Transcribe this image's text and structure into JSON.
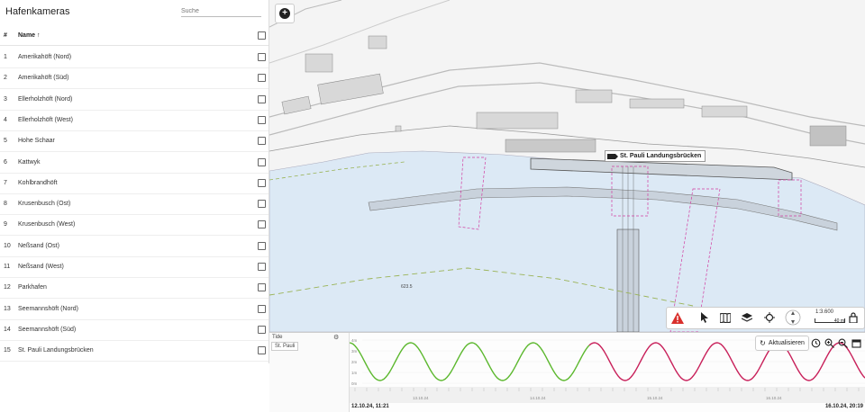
{
  "panel": {
    "title": "Hafenkameras",
    "search_placeholder": "Suche",
    "col_num": "#",
    "col_name": "Name ↑",
    "rows": [
      {
        "n": "1",
        "name": "Amerikahöft (Nord)"
      },
      {
        "n": "2",
        "name": "Amerikahöft (Süd)"
      },
      {
        "n": "3",
        "name": "Ellerholzhöft (Nord)"
      },
      {
        "n": "4",
        "name": "Ellerholzhöft (West)"
      },
      {
        "n": "5",
        "name": "Hohe Schaar"
      },
      {
        "n": "6",
        "name": "Kattwyk"
      },
      {
        "n": "7",
        "name": "Kohlbrandhöft"
      },
      {
        "n": "8",
        "name": "Krusenbusch (Ost)"
      },
      {
        "n": "9",
        "name": "Krusenbusch (West)"
      },
      {
        "n": "10",
        "name": "Neßsand (Ost)"
      },
      {
        "n": "11",
        "name": "Neßsand (West)"
      },
      {
        "n": "12",
        "name": "Parkhafen"
      },
      {
        "n": "13",
        "name": "Seemannshöft (Nord)"
      },
      {
        "n": "14",
        "name": "Seemannshöft (Süd)"
      },
      {
        "n": "15",
        "name": "St. Pauli Landungsbrücken"
      }
    ]
  },
  "map": {
    "camera_label": "St. Pauli Landungsbrücken",
    "depth_label": "623.5",
    "scale_text": "1:3.600",
    "scale_bar_text": "40 m",
    "water_color": "#dce9f5",
    "land_color": "#f4f4f4",
    "building_color": "#d8d8d8",
    "alert_color": "#d9302c"
  },
  "tide": {
    "title": "Tide",
    "station": "St. Pauli",
    "refresh_label": "Aktualisieren",
    "start_label": "12.10.24, 11:21",
    "end_label": "16.10.24, 20:19",
    "date_labels": [
      "13.10.24",
      "14.10.24",
      "15.10.24",
      "16.10.24"
    ],
    "y_labels": [
      "4m",
      "3m",
      "2m",
      "1m",
      "0m"
    ],
    "measured_color": "#5cb82e",
    "forecast_color": "#c8205a"
  }
}
